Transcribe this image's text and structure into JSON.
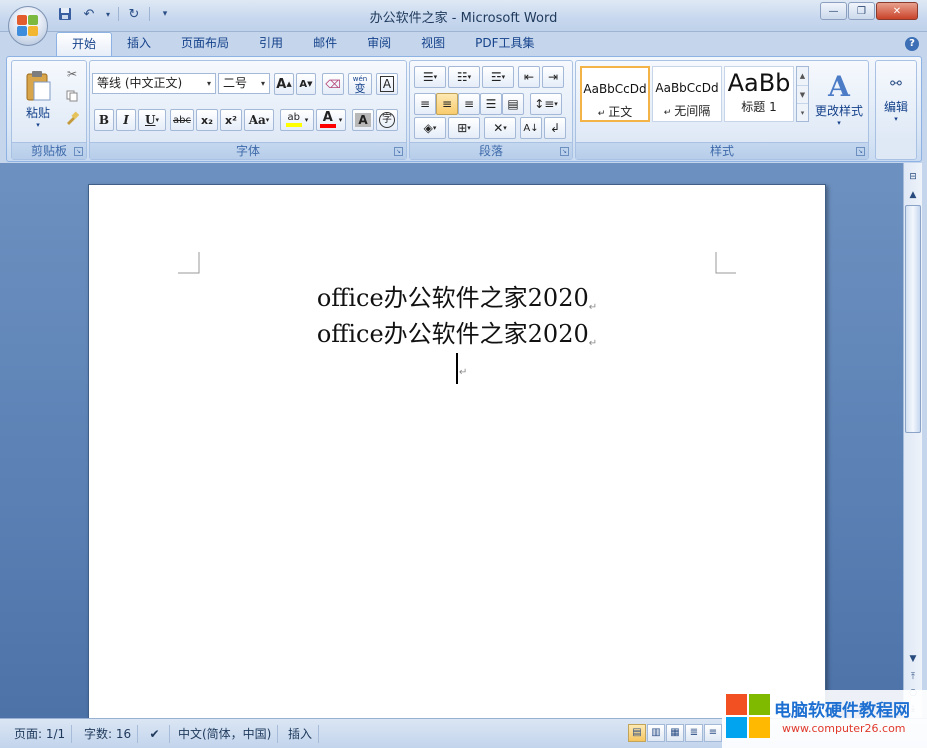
{
  "window": {
    "title": "办公软件之家 - Microsoft Word",
    "controls": [
      "minimize",
      "restore",
      "close"
    ]
  },
  "quick_access": {
    "icons": [
      "save-icon",
      "undo-icon",
      "redo-icon",
      "customize-icon"
    ]
  },
  "tabs": [
    {
      "label": "开始",
      "active": true
    },
    {
      "label": "插入"
    },
    {
      "label": "页面布局"
    },
    {
      "label": "引用"
    },
    {
      "label": "邮件"
    },
    {
      "label": "审阅"
    },
    {
      "label": "视图"
    },
    {
      "label": "PDF工具集"
    }
  ],
  "ribbon": {
    "clipboard": {
      "label": "剪贴板",
      "paste_label": "粘贴"
    },
    "font": {
      "label": "字体",
      "font_name": "等线 (中文正文)",
      "font_size": "二号",
      "grow": "A",
      "shrink": "A",
      "bold": "B",
      "italic": "I",
      "underline": "U",
      "strike": "abc",
      "subscript": "x₂",
      "superscript": "x²",
      "change_case": "Aa",
      "highlight": "ab",
      "font_color": "A",
      "char_shading": "A",
      "enclose": "字",
      "phonetic": "wén",
      "phonetic_char": "变",
      "char_border": "A"
    },
    "paragraph": {
      "label": "段落"
    },
    "styles": {
      "label": "样式",
      "items": [
        {
          "sample": "AaBbCcDd",
          "name": "正文",
          "selected": true
        },
        {
          "sample": "AaBbCcDd",
          "name": "无间隔"
        },
        {
          "sample": "AaBb",
          "name": "标题 1"
        }
      ],
      "change_styles": "更改样式"
    },
    "editing": {
      "label": "编辑"
    }
  },
  "document": {
    "lines": [
      "office办公软件之家2020",
      "office办公软件之家2020"
    ],
    "para_mark": "↵"
  },
  "status": {
    "page": "页面: 1/1",
    "words": "字数: 16",
    "language": "中文(简体，中国)",
    "mode": "插入"
  },
  "watermark": {
    "title": "电脑软硬件教程网",
    "url": "www.computer26.com"
  },
  "colors": {
    "accent": "#15428b",
    "doc_bg": "#5a80b4",
    "font_color_bar": "#ff0000",
    "highlight_bar": "#ffff00"
  }
}
